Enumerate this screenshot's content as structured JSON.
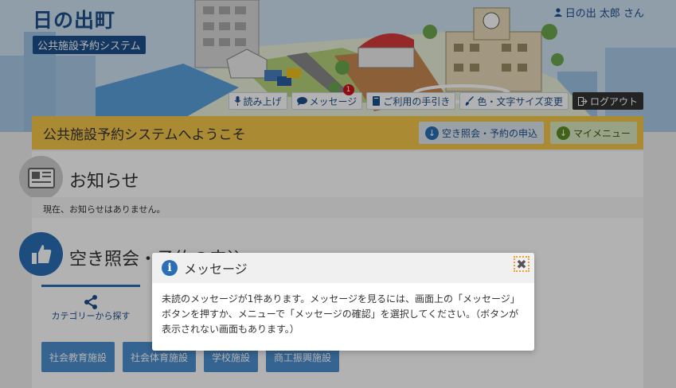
{
  "header": {
    "town_name": "日の出町",
    "system_name": "公共施設予約システム",
    "user_name": "日の出 太郎 さん",
    "utility": {
      "read_aloud": "読み上げ",
      "message": "メッセージ",
      "message_count": "1",
      "guide": "ご利用の手引き",
      "color_font": "色・文字サイズ変更",
      "logout": "ログアウト"
    }
  },
  "welcome": {
    "text": "公共施設予約システムへようこそ",
    "reserve_button": "空き照会・予約の申込",
    "mymenu_button": "マイメニュー"
  },
  "notice": {
    "title": "お知らせ",
    "empty_text": "現在、お知らせはありません。"
  },
  "search": {
    "title": "空き照会・予約の申込",
    "tab_category": "カテゴリーから探す",
    "categories": [
      "社会教育施設",
      "社会体育施設",
      "学校施設",
      "商工振興施設"
    ]
  },
  "dialog": {
    "title": "メッセージ",
    "close": "✖",
    "body": "未読のメッセージが1件あります。メッセージを見るには、画面上の「メッセージ」ボタンを押すか、メニューで「メッセージの確認」を選択してください。（ボタンが表示されない画面もあります。）"
  },
  "colors": {
    "primary": "#1d4f8c",
    "accent_blue": "#2a6fb5",
    "welcome_yellow": "#f4c84a",
    "category_blue": "#4c90d0"
  }
}
